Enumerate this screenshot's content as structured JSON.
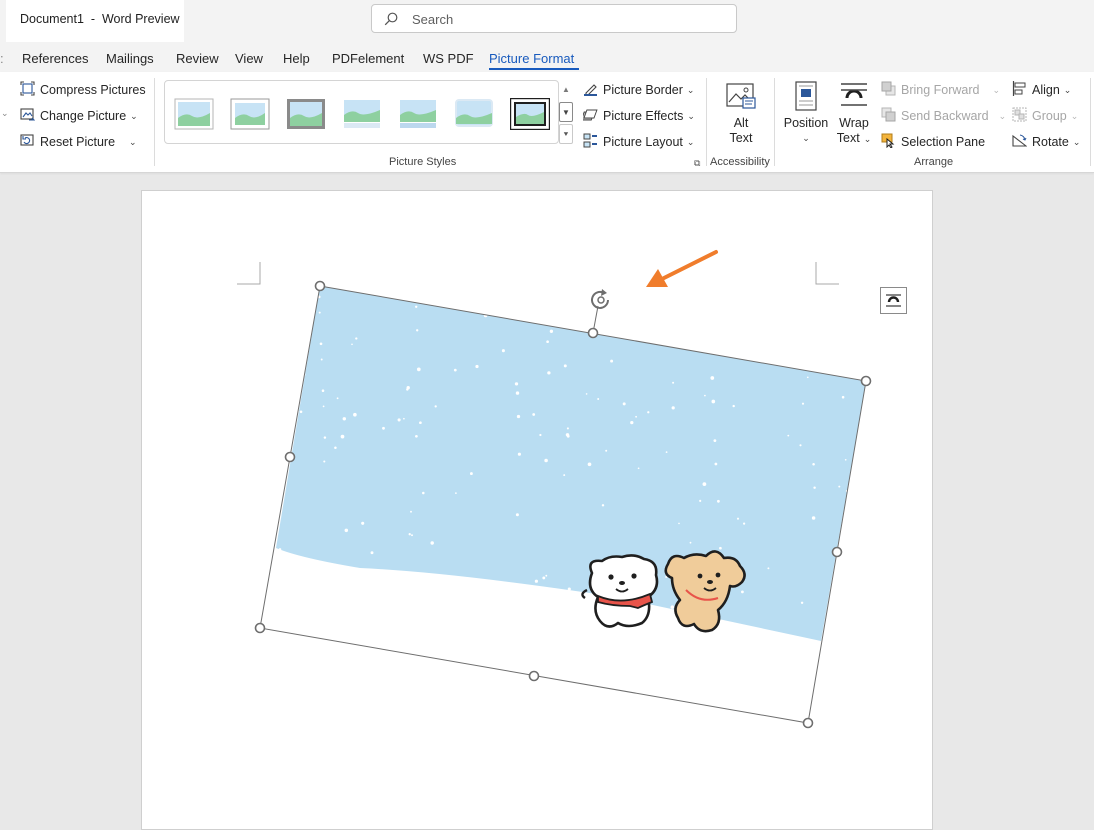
{
  "window": {
    "title": "Document1  -  Word Preview",
    "search_placeholder": "Search"
  },
  "tabs": [
    {
      "label": "References"
    },
    {
      "label": "Mailings"
    },
    {
      "label": "Review"
    },
    {
      "label": "View"
    },
    {
      "label": "Help"
    },
    {
      "label": "PDFelement"
    },
    {
      "label": "WS PDF"
    },
    {
      "label": "Picture Format",
      "active": true
    }
  ],
  "ribbon": {
    "adjust": {
      "compress_label": "Compress Pictures",
      "change_label": "Change Picture",
      "reset_label": "Reset Picture"
    },
    "picture_styles": {
      "group_label": "Picture Styles",
      "border_label": "Picture Border",
      "effects_label": "Picture Effects",
      "layout_label": "Picture Layout",
      "selected_style_index": 6
    },
    "accessibility": {
      "alt_text_line1": "Alt",
      "alt_text_line2": "Text",
      "group_label": "Accessibility"
    },
    "arrange": {
      "position_label": "Position",
      "wrap_line1": "Wrap",
      "wrap_line2": "Text",
      "bring_forward_label": "Bring Forward",
      "send_backward_label": "Send Backward",
      "selection_pane_label": "Selection Pane",
      "align_label": "Align",
      "group_btn_label": "Group",
      "rotate_label": "Rotate",
      "group_label": "Arrange"
    }
  },
  "colors": {
    "accent": "#185abd",
    "sky": "#b9ddf2",
    "annotation_arrow": "#f07d2c",
    "snow": "#ffffff"
  },
  "icons": [
    "search-icon",
    "compress-pictures-icon",
    "change-picture-icon",
    "reset-picture-icon",
    "picture-border-icon",
    "picture-effects-icon",
    "picture-layout-icon",
    "alt-text-icon",
    "position-icon",
    "wrap-text-icon",
    "bring-forward-icon",
    "send-backward-icon",
    "selection-pane-icon",
    "align-icon",
    "group-icon",
    "rotate-icon",
    "rotation-handle-icon",
    "layout-options-icon"
  ]
}
